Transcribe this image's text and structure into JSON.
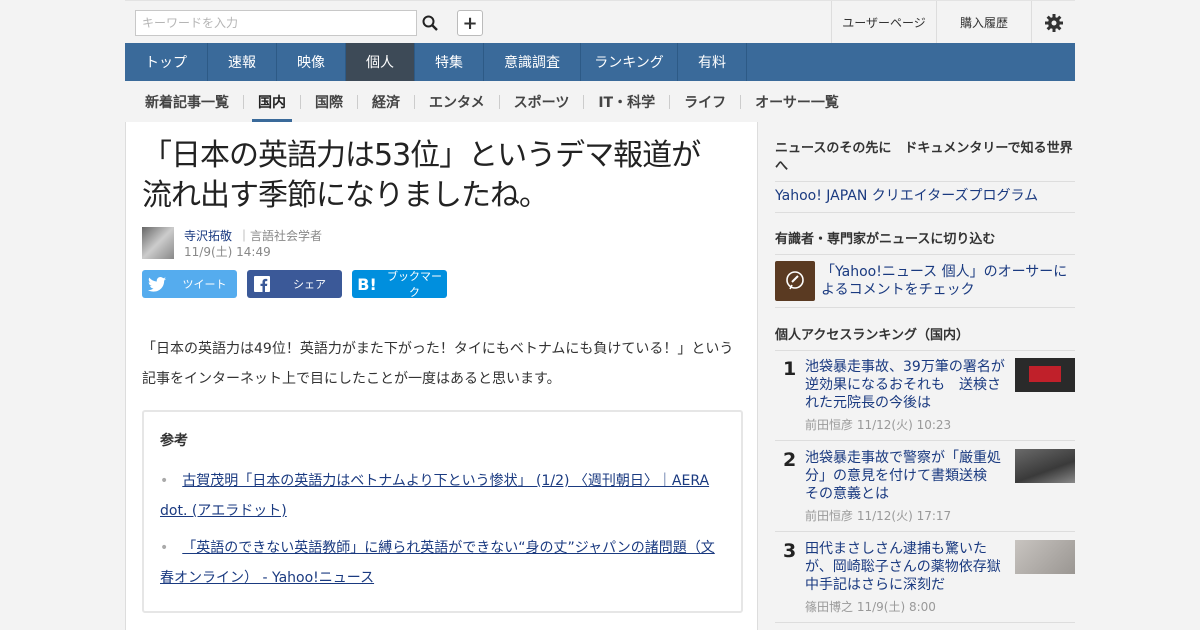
{
  "search": {
    "placeholder": "キーワードを入力"
  },
  "topnav": {
    "user": "ユーザーページ",
    "history": "購入履歴"
  },
  "mainnav": [
    "トップ",
    "速報",
    "映像",
    "個人",
    "特集",
    "意識調査",
    "ランキング",
    "有料"
  ],
  "subnav": [
    "新着記事一覧",
    "国内",
    "国際",
    "経済",
    "エンタメ",
    "スポーツ",
    "IT・科学",
    "ライフ",
    "オーサー一覧"
  ],
  "article": {
    "title_line1": "「日本の英語力は53位」というデマ報道が",
    "title_line2": "流れ出す季節になりましたね。",
    "author": "寺沢拓敬",
    "role": "言語社会学者",
    "date": "11/9(土) 14:49",
    "share_tweet": "ツイート",
    "share_fb": "シェア",
    "share_hatena": "ブックマーク",
    "body": "「日本の英語力は49位！英語力がまた下がった！タイにもベトナムにも負けている！」という記事をインターネット上で目にしたことが一度はあると思います。",
    "ref_title": "参考",
    "refs": [
      "古賀茂明「日本の英語力はベトナムより下という惨状」 (1/2) 〈週刊朝日〉｜AERA dot. (アエラドット)",
      "「英語のできない英語教師」に縛られ英語ができない“身の丈”ジャパンの諸問題（文春オンライン） - Yahoo!ニュース"
    ]
  },
  "sidebar": {
    "promo_head": "ニュースのその先に　ドキュメンタリーで知る世界へ",
    "promo_link": "Yahoo! JAPAN クリエイターズプログラム",
    "expert_head": "有識者・専門家がニュースに切り込む",
    "expert_link": "「Yahoo!ニュース 個人」のオーサーによるコメントをチェック",
    "ranking_head": "個人アクセスランキング（国内）",
    "ranking": [
      {
        "num": "1",
        "title": "池袋暴走事故、39万筆の署名が逆効果になるおそれも　送検された元院長の今後は",
        "meta": "前田恒彦  11/12(火) 10:23"
      },
      {
        "num": "2",
        "title": "池袋暴走事故で警察が「厳重処分」の意見を付けて書類送検　その意義とは",
        "meta": "前田恒彦  11/12(火) 17:17"
      },
      {
        "num": "3",
        "title": "田代まさしさん逮捕も驚いたが、岡崎聡子さんの薬物依存獄中手記はさらに深刻だ",
        "meta": "篠田博之  11/9(土) 8:00"
      }
    ]
  }
}
